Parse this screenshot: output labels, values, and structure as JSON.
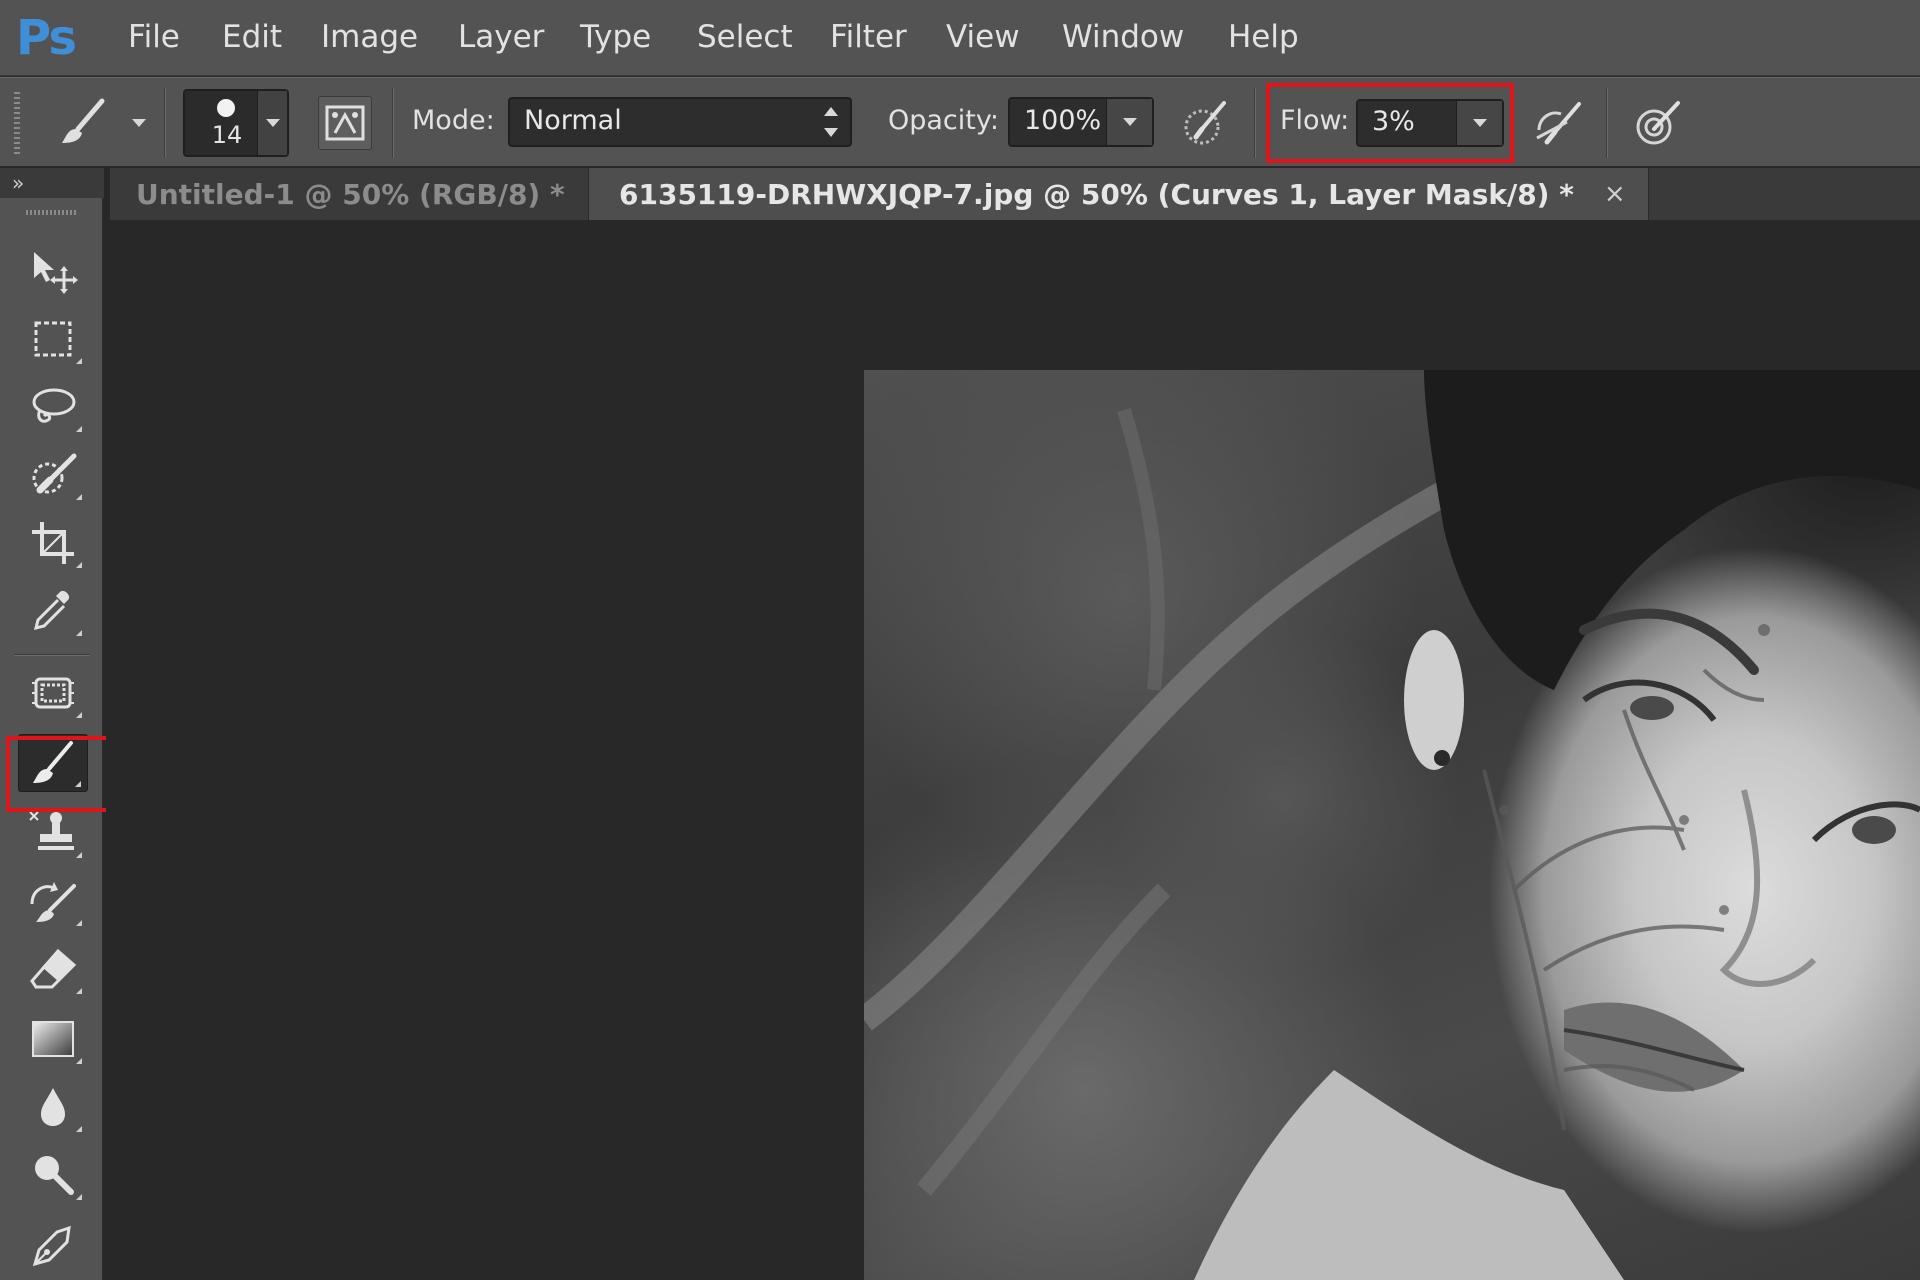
{
  "app": {
    "logo": "Ps",
    "menu": [
      "File",
      "Edit",
      "Image",
      "Layer",
      "Type",
      "Select",
      "Filter",
      "View",
      "Window",
      "Help"
    ]
  },
  "options_bar": {
    "brush_size": "14",
    "mode_label": "Mode:",
    "mode_value": "Normal",
    "opacity_label": "Opacity:",
    "opacity_value": "100%",
    "flow_label": "Flow:",
    "flow_value": "3%",
    "highlight_color": "#e0141b"
  },
  "tabs": [
    {
      "label": "Untitled-1 @ 50% (RGB/8) *",
      "close": "×",
      "active": false
    },
    {
      "label": "6135119-DRHWXJQP-7.jpg @ 50% (Curves 1, Layer Mask/8) *",
      "close": "×",
      "active": true
    }
  ],
  "toolbar": {
    "expand_glyph": "»",
    "tools": [
      {
        "name": "move-tool",
        "icon": "move-icon"
      },
      {
        "name": "rectangular-marquee-tool",
        "icon": "marquee-icon"
      },
      {
        "name": "lasso-tool",
        "icon": "lasso-icon"
      },
      {
        "name": "quick-selection-tool",
        "icon": "quick-selection-icon"
      },
      {
        "name": "crop-tool",
        "icon": "crop-icon"
      },
      {
        "name": "eyedropper-tool",
        "icon": "eyedropper-icon"
      },
      {
        "name": "spot-healing-tool",
        "icon": "healing-patch-icon"
      },
      {
        "name": "brush-tool",
        "icon": "brush-icon",
        "selected": true
      },
      {
        "name": "clone-stamp-tool",
        "icon": "stamp-icon"
      },
      {
        "name": "history-brush-tool",
        "icon": "history-brush-icon"
      },
      {
        "name": "eraser-tool",
        "icon": "eraser-icon"
      },
      {
        "name": "gradient-tool",
        "icon": "gradient-icon"
      },
      {
        "name": "blur-tool",
        "icon": "drop-icon"
      },
      {
        "name": "dodge-tool",
        "icon": "dodge-icon"
      },
      {
        "name": "pen-tool",
        "icon": "pen-icon"
      }
    ]
  }
}
